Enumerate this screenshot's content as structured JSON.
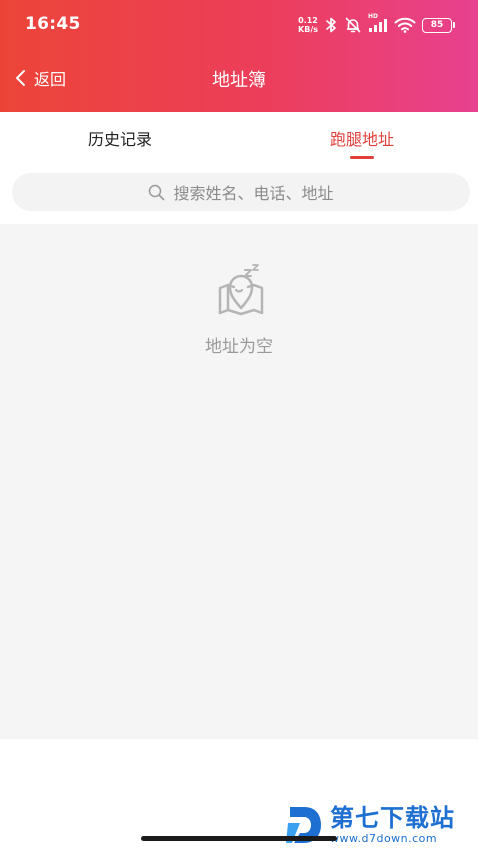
{
  "status_bar": {
    "time": "16:45",
    "net_speed_value": "0.12",
    "net_speed_unit": "KB/s",
    "battery": "85",
    "hd_label": "HD",
    "icons": [
      "bluetooth-icon",
      "bell-muted-icon",
      "signal-icon",
      "wifi-icon",
      "battery-icon"
    ]
  },
  "nav": {
    "back_label": "返回",
    "title": "地址簿"
  },
  "tabs": [
    {
      "label": "历史记录",
      "active": false
    },
    {
      "label": "跑腿地址",
      "active": true
    }
  ],
  "search": {
    "placeholder": "搜索姓名、电话、地址"
  },
  "empty_state": {
    "text": "地址为空",
    "icon": "empty-map-sleep-icon"
  },
  "watermark": {
    "main": "第七下载站",
    "url": "www.d7down.com",
    "logo_letter": "D"
  },
  "colors": {
    "header_gradient_start": "#ec4538",
    "header_gradient_end": "#e8418f",
    "accent": "#e0413c",
    "watermark": "#1d6fd1"
  }
}
